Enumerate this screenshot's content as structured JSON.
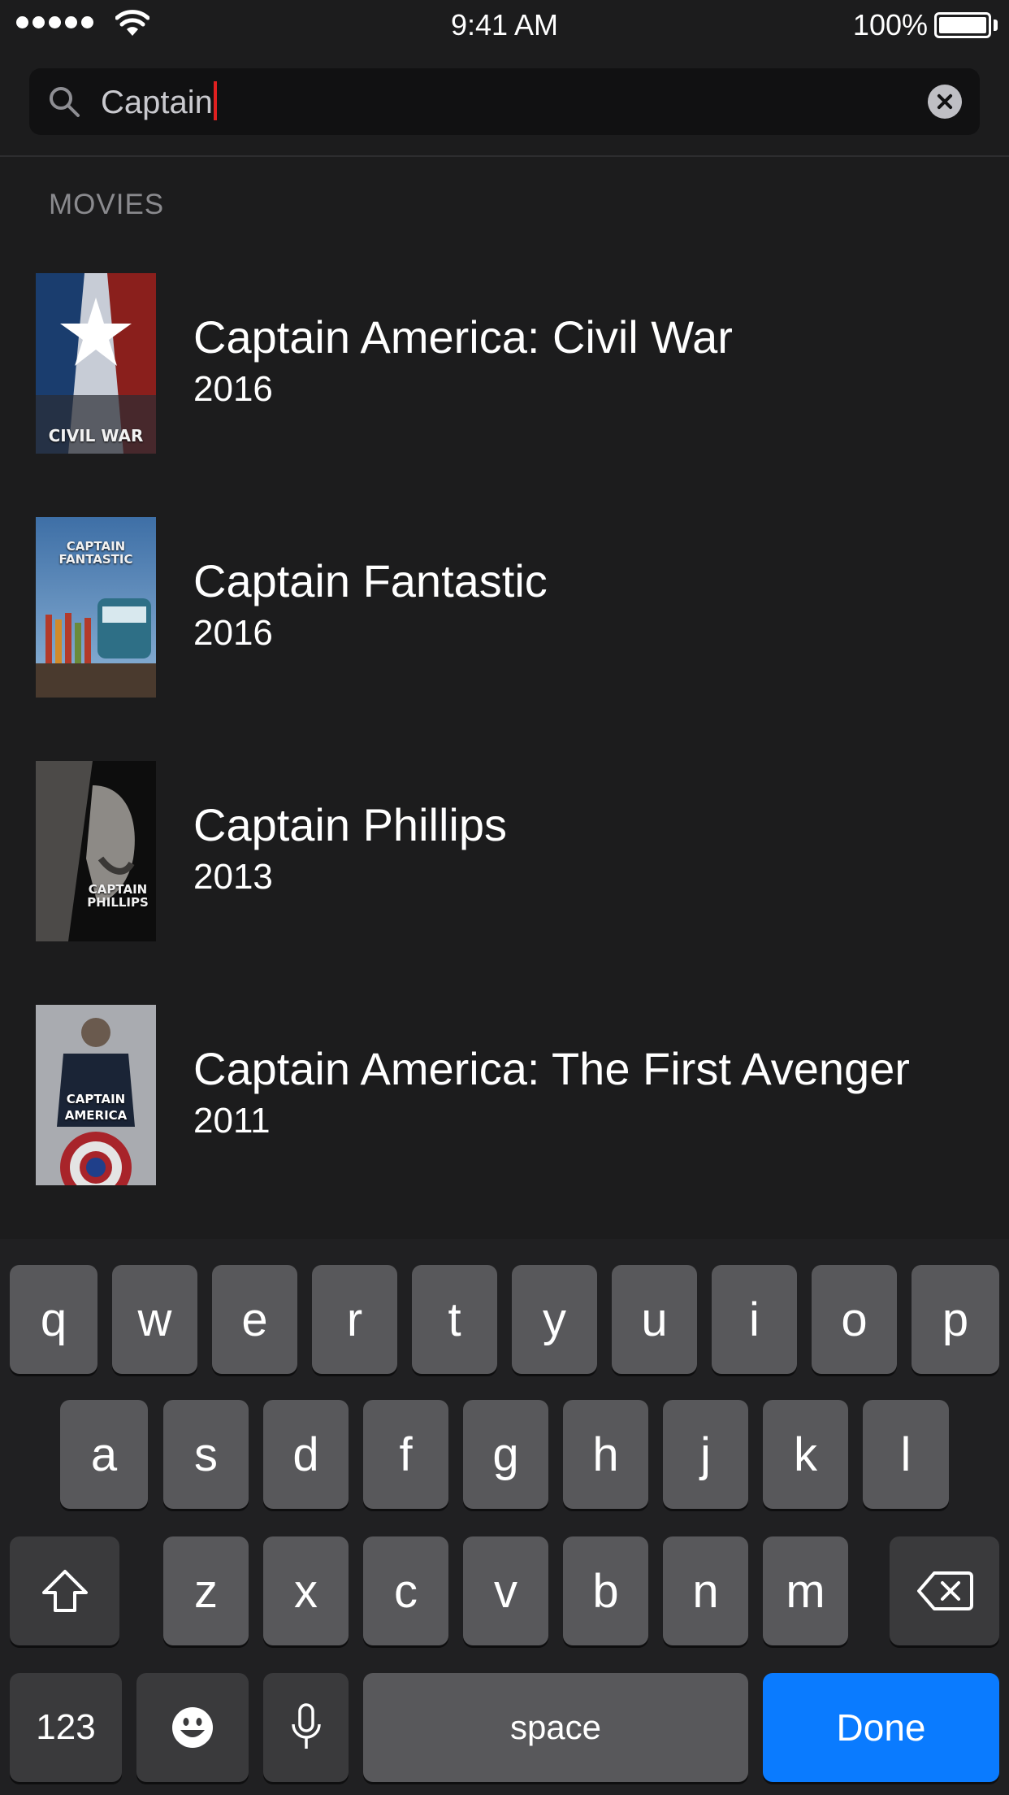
{
  "status_bar": {
    "time": "9:41 AM",
    "battery_percent": "100%",
    "signal_dots": 5
  },
  "search": {
    "query": "Captain",
    "clear_icon": "clear-circle-icon",
    "search_icon": "magnifier-icon"
  },
  "results": {
    "section_label": "MOVIES",
    "items": [
      {
        "title": "Captain America: Civil War",
        "year": "2016",
        "poster_text": "CIVIL WAR",
        "poster_colors": [
          "#1a3d6e",
          "#c7ccd6",
          "#8a1f1c"
        ]
      },
      {
        "title": "Captain Fantastic",
        "year": "2016",
        "poster_text": "CAPTAIN FANTASTIC",
        "poster_colors": [
          "#3e6fa6",
          "#8fb5d8",
          "#b33a2a"
        ]
      },
      {
        "title": "Captain Phillips",
        "year": "2013",
        "poster_text": "CAPTAIN PHILLIPS",
        "poster_colors": [
          "#0d0d0d",
          "#8d8a86",
          "#4c4a48"
        ]
      },
      {
        "title": "Captain America: The First Avenger",
        "year": "2011",
        "poster_text": "CAPTAIN AMERICA",
        "poster_colors": [
          "#1a2436",
          "#d8d8d8",
          "#a8242a"
        ]
      }
    ]
  },
  "keyboard": {
    "row1": [
      "q",
      "w",
      "e",
      "r",
      "t",
      "y",
      "u",
      "i",
      "o",
      "p"
    ],
    "row2": [
      "a",
      "s",
      "d",
      "f",
      "g",
      "h",
      "j",
      "k",
      "l"
    ],
    "row3": [
      "z",
      "x",
      "c",
      "v",
      "b",
      "n",
      "m"
    ],
    "shift_icon": "shift-arrow-icon",
    "delete_icon": "backspace-icon",
    "numbers_label": "123",
    "emoji_icon": "emoji-icon",
    "mic_icon": "microphone-icon",
    "space_label": "space",
    "done_label": "Done",
    "done_color": "#0a7bff"
  }
}
